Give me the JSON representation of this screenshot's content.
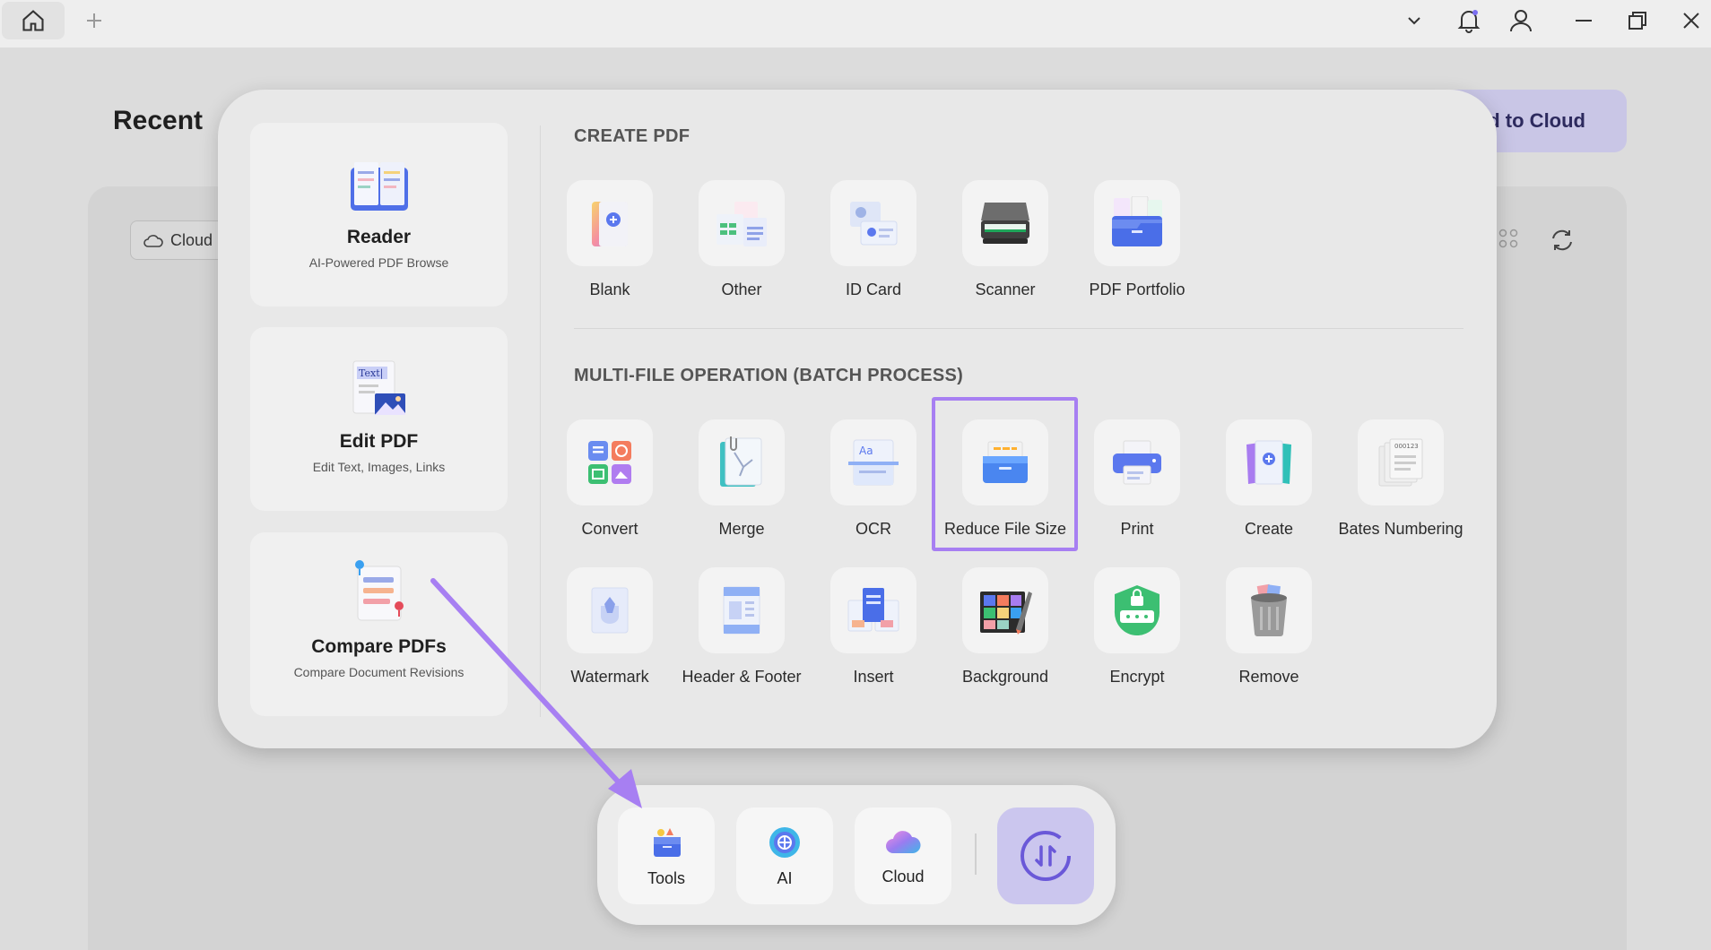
{
  "window": {
    "title_icons": [
      "home-icon",
      "new-tab-plus-icon",
      "chevron-down-icon",
      "bell-icon",
      "user-icon",
      "minimize-icon",
      "restore-icon",
      "close-icon"
    ]
  },
  "background": {
    "recent_title": "Recent",
    "cloud_chip": "Cloud",
    "upload_button": "d to Cloud"
  },
  "popup": {
    "side_cards": [
      {
        "title": "Reader",
        "subtitle": "AI-Powered PDF Browse"
      },
      {
        "title": "Edit PDF",
        "subtitle": "Edit Text, Images, Links",
        "art_text": "Text|"
      },
      {
        "title": "Compare PDFs",
        "subtitle": "Compare Document Revisions"
      }
    ],
    "create_pdf": {
      "heading": "CREATE PDF",
      "tools": [
        "Blank",
        "Other",
        "ID Card",
        "Scanner",
        "PDF Portfolio"
      ]
    },
    "batch": {
      "heading": "MULTI-FILE OPERATION (BATCH PROCESS)",
      "row1": [
        "Convert",
        "Merge",
        "OCR",
        "Reduce File Size",
        "Print",
        "Create",
        "Bates Numbering"
      ],
      "row2": [
        "Watermark",
        "Header & Footer",
        "Insert",
        "Background",
        "Encrypt",
        "Remove"
      ],
      "highlighted": "Reduce File Size",
      "ocr_art_text": "Aa",
      "bates_art_text": "000123"
    }
  },
  "dock": {
    "items": [
      "Tools",
      "AI",
      "Cloud"
    ]
  },
  "colors": {
    "accent": "#a77ff2",
    "switch_bg": "#cbc6ee"
  }
}
